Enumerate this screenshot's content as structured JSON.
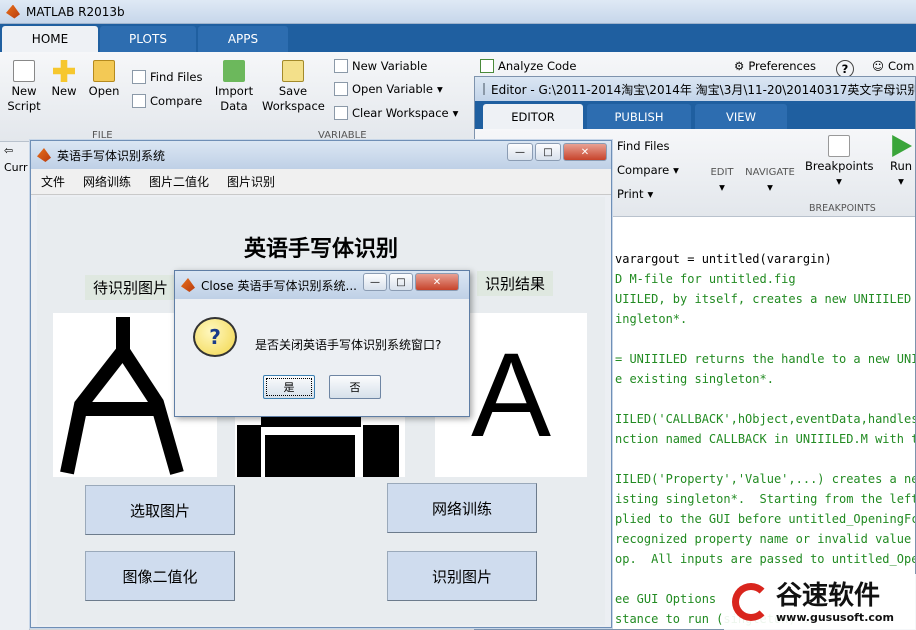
{
  "window": {
    "title": "MATLAB R2013b"
  },
  "main_tabs": [
    "HOME",
    "PLOTS",
    "APPS"
  ],
  "ribbon": {
    "new_script": "New\nScript",
    "new": "New",
    "open": "Open",
    "find_files": "Find Files",
    "compare": "Compare",
    "import_data": "Import\nData",
    "save_workspace": "Save\nWorkspace",
    "new_variable": "New Variable",
    "open_variable": "Open Variable",
    "clear_workspace": "Clear Workspace",
    "analyze_code": "Analyze Code",
    "preferences": "Preferences",
    "community": "Com",
    "group_file": "FILE",
    "group_variable": "VARIABLE",
    "address_partial": "Curr"
  },
  "editor": {
    "title": "Editor - G:\\2011-2014淘宝\\2014年 淘宝\\3月\\11-20\\20140317英文字母识别",
    "tabs": [
      "EDITOR",
      "PUBLISH",
      "VIEW"
    ],
    "find_files": "Find Files",
    "compare": "Compare",
    "print": "Print",
    "edit": "EDIT",
    "navigate": "NAVIGATE",
    "breakpoints": "Breakpoints",
    "breakpoints_group": "BREAKPOINTS",
    "run": "Run",
    "code_lines": [
      {
        "text": "varargout = untitled(varargin)",
        "comment": false
      },
      {
        "text": "D M-file for untitled.fig",
        "comment": true
      },
      {
        "text": "UIILED, by itself, creates a new UNIIILED o",
        "comment": true
      },
      {
        "text": "ingleton*.",
        "comment": true
      },
      {
        "text": "",
        "comment": true
      },
      {
        "text": "= UNIIILED returns the handle to a new UNII",
        "comment": true
      },
      {
        "text": "e existing singleton*.",
        "comment": true
      },
      {
        "text": "",
        "comment": true
      },
      {
        "text": "IILED('CALLBACK',hObject,eventData,handles,",
        "comment": true
      },
      {
        "text": "nction named CALLBACK in UNIIILED.M with th",
        "comment": true
      },
      {
        "text": "",
        "comment": true
      },
      {
        "text": "IILED('Property','Value',...) creates a new",
        "comment": true
      },
      {
        "text": "isting singleton*.  Starting from the left,",
        "comment": true
      },
      {
        "text": "plied to the GUI before untitled_OpeningFcn",
        "comment": true
      },
      {
        "text": "recognized property name or invalid value m",
        "comment": true
      },
      {
        "text": "op.  All inputs are passed to untitled_Open",
        "comment": true
      },
      {
        "text": "",
        "comment": true
      },
      {
        "text": "ee GUI Options",
        "comment": true
      },
      {
        "text": "stance to run (singleton)\".",
        "comment": true
      }
    ]
  },
  "figure": {
    "title": "英语手写体识别系统",
    "menu": [
      "文件",
      "网络训练",
      "图片二值化",
      "图片识别"
    ],
    "heading": "英语手写体识别",
    "label_input": "待识别图片",
    "label_result": "识别结果",
    "result_char": "A",
    "buttons": {
      "select": "选取图片",
      "train": "网络训练",
      "binarize": "图像二值化",
      "recognize": "识别图片"
    }
  },
  "dialog": {
    "title": "Close 英语手写体识别系统...",
    "message": "是否关闭英语手写体识别系统窗口?",
    "yes": "是",
    "no": "否"
  },
  "watermark": {
    "brand": "谷速软件",
    "url": "www.gususoft.com"
  },
  "colors": {
    "ribbon_blue": "#1f5fa0",
    "button_blue": "#cfdcee",
    "comment_green": "#228b22"
  }
}
